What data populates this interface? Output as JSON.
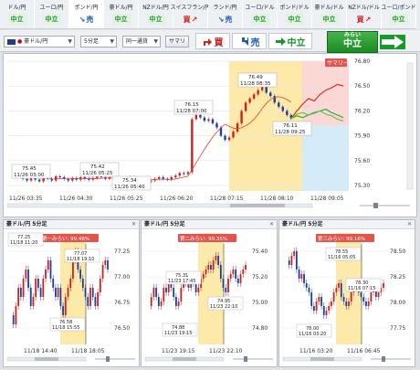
{
  "tabs": [
    {
      "name": "ドル/円",
      "signal": "中立"
    },
    {
      "name": "ユーロ/円",
      "signal": "中立"
    },
    {
      "name": "ポンド/円",
      "signal": "売"
    },
    {
      "name": "豪ドル/円",
      "signal": "中立"
    },
    {
      "name": "NZドル/円",
      "signal": "中立"
    },
    {
      "name": "スイスフラン/円",
      "signal": "買"
    },
    {
      "name": "ランド/円",
      "signal": "売"
    },
    {
      "name": "ユーロ/ドル",
      "signal": "中立"
    },
    {
      "name": "ポンド/ドル",
      "signal": "中立"
    },
    {
      "name": "豪ドル/ドル",
      "signal": "中立"
    },
    {
      "name": "NZドル/ドル",
      "signal": "買"
    },
    {
      "name": "ユーロ/ポンド",
      "signal": "中立"
    }
  ],
  "toolbar": {
    "pair": "豪ドル/円",
    "interval": "5分足",
    "compare": "同一通貨",
    "summary_button": "サマリ",
    "buy": "買",
    "sell": "売",
    "neutral": "中立",
    "mirai_label": "みらい",
    "mirai_value": "中立"
  },
  "main_chart": {
    "summary_tag": "サマリー",
    "y_ticks": [
      "76.80",
      "76.50",
      "76.20",
      "75.90",
      "75.60",
      "75.30"
    ],
    "x_ticks": [
      "11/26 03:35",
      "11/26 04:30",
      "11/26 05:25",
      "11/26 06:20",
      "11/28 07:15",
      "11/28 08:10",
      "11/28 09:05"
    ],
    "annotations": [
      {
        "v": "75.45",
        "t": "11/26 03:00"
      },
      {
        "v": "75.42",
        "t": "11/26 05:25"
      },
      {
        "v": "75.34",
        "t": "11/26 05:40"
      },
      {
        "v": "76.15",
        "t": "11/28 07:00"
      },
      {
        "v": "76.49",
        "t": "11/28 08:35"
      },
      {
        "v": "76.11",
        "t": "11/28 09:25"
      }
    ]
  },
  "mini_charts": [
    {
      "title": "豪ドル/円 5分足",
      "match": "第一みらい: 99.48%",
      "y_ticks": [
        "77.25",
        "77.00",
        "76.75",
        "76.50"
      ],
      "x_ticks": [
        "11/18 14:40",
        "11/18 18:05"
      ],
      "annotations": [
        {
          "v": "77.25",
          "t": "11/18 11:20"
        },
        {
          "v": "77.07",
          "t": "11/18 19:10"
        },
        {
          "v": "76.58",
          "t": "11/18 15:55"
        }
      ]
    },
    {
      "title": "豪ドル/円 5分足",
      "match": "第二みらい: 99.35%",
      "y_ticks": [
        "75.40",
        "75.20",
        "75.00",
        "74.80"
      ],
      "x_ticks": [
        "11/23 19:15",
        "11/23 22:10"
      ],
      "annotations": [
        {
          "v": "75.31",
          "t": "11/23 17:45"
        },
        {
          "v": "74.95",
          "t": "11/23 22:10"
        },
        {
          "v": "74.88",
          "t": "11/23 19:15"
        }
      ]
    },
    {
      "title": "豪ドル/円 5分足",
      "match": "第三みらい: 99.16%",
      "y_ticks": [
        "78.50",
        "78.25",
        "78.00",
        "77.75"
      ],
      "x_ticks": [
        "11/16 03:20",
        "11/16 06:45"
      ],
      "annotations": [
        {
          "v": "78.55",
          "t": "11/16 05:05"
        },
        {
          "v": "78.30",
          "t": "11/16 07:15"
        },
        {
          "v": "78.00",
          "t": "11/16 03:20"
        }
      ]
    }
  ],
  "colors": {
    "buy": "#d0201c",
    "sell": "#1a5fb4",
    "neutral": "#169a2a",
    "highlight": "#fde9a8"
  }
}
